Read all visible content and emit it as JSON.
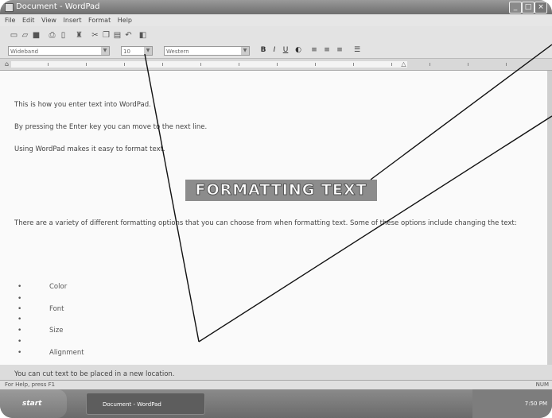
{
  "window": {
    "title": "Document - WordPad",
    "min_label": "_",
    "max_label": "□",
    "close_label": "×"
  },
  "menu": [
    "File",
    "Edit",
    "View",
    "Insert",
    "Format",
    "Help"
  ],
  "format_bar": {
    "font": "Wideband",
    "size": "10",
    "script": "Western",
    "bold_label": "B",
    "italic_label": "I",
    "underline_label": "U"
  },
  "document": {
    "line1": "This is how you enter text into WordPad.",
    "line2": "By pressing the Enter key you can move to the next line.",
    "line3": "Using WordPad makes it easy to format text.",
    "headline": "FORMATTING TEXT",
    "paragraph": "There are a variety of different formatting options that you can choose from when formatting text.  Some of these options include changing the text:",
    "bullet_symbol": "•",
    "items": [
      "Color",
      "Font",
      "Size",
      "Alignment"
    ],
    "last_line": "You can cut text to be placed in a new location."
  },
  "status": {
    "help": "For Help, press F1",
    "indicator": "NUM"
  },
  "taskbar": {
    "start": "start",
    "task": "Document - WordPad",
    "clock": "7:50 PM"
  }
}
